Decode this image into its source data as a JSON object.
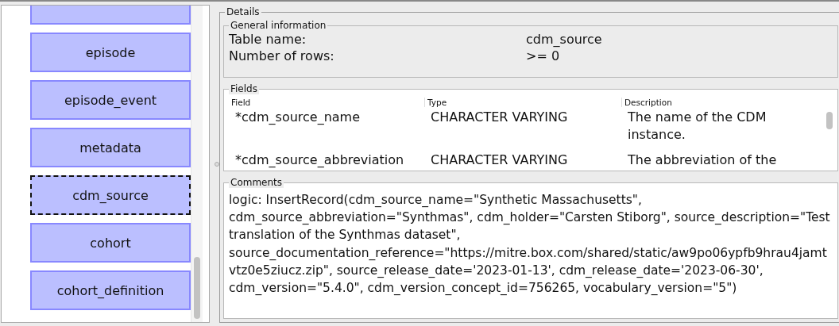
{
  "table_list": {
    "items": [
      {
        "label": "episode",
        "selected": false
      },
      {
        "label": "episode_event",
        "selected": false
      },
      {
        "label": "metadata",
        "selected": false
      },
      {
        "label": "cdm_source",
        "selected": true
      },
      {
        "label": "cohort",
        "selected": false
      },
      {
        "label": "cohort_definition",
        "selected": false
      }
    ]
  },
  "details": {
    "title": "Details",
    "general_information": {
      "title": "General information",
      "rows": [
        {
          "label": "Table name:",
          "value": "cdm_source"
        },
        {
          "label": "Number of rows:",
          "value": ">= 0"
        }
      ]
    },
    "fields": {
      "title": "Fields",
      "columns": [
        "Field",
        "Type",
        "Description"
      ],
      "rows": [
        {
          "field": "*cdm_source_name",
          "type": "CHARACTER VARYING",
          "description": "The name of the CDM instance."
        },
        {
          "field": "*cdm_source_abbreviation",
          "type": "CHARACTER VARYING",
          "description": "The abbreviation of the"
        }
      ]
    },
    "comments": {
      "title": "Comments",
      "value": "logic: InsertRecord(cdm_source_name=\"Synthetic Massachusetts\", cdm_source_abbreviation=\"Synthmas\", cdm_holder=\"Carsten Stiborg\", source_description=\"Test translation of the Synthmas dataset\", source_documentation_reference=\"https://mitre.box.com/shared/static/aw9po06ypfb9hrau4jamtvtz0e5ziucz.zip\", source_release_date='2023-01-13', cdm_release_date='2023-06-30', cdm_version=\"5.4.0\", cdm_version_concept_id=756265, vocabulary_version=\"5\")"
    }
  }
}
